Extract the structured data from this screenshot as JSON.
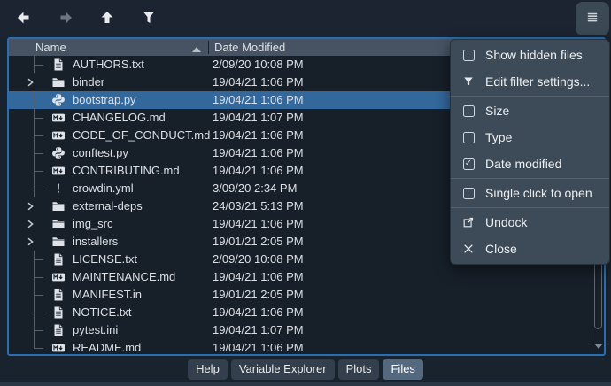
{
  "toolbar": {
    "back_label": "back",
    "forward_label": "forward",
    "up_label": "parent directory",
    "filter_label": "filter",
    "options_label": "options menu"
  },
  "file_browser": {
    "columns": {
      "name": "Name",
      "date": "Date Modified"
    },
    "sort": {
      "column": "Name",
      "direction": "ascending"
    },
    "rows": [
      {
        "name": "AUTHORS.txt",
        "date": "2/09/20 10:08 PM",
        "type": "text",
        "selected": false
      },
      {
        "name": "binder",
        "date": "19/04/21 1:06 PM",
        "type": "folder",
        "selected": false
      },
      {
        "name": "bootstrap.py",
        "date": "19/04/21 1:06 PM",
        "type": "python",
        "selected": true
      },
      {
        "name": "CHANGELOG.md",
        "date": "19/04/21 1:07 PM",
        "type": "markdown",
        "selected": false
      },
      {
        "name": "CODE_OF_CONDUCT.md",
        "date": "19/04/21 1:06 PM",
        "type": "markdown",
        "selected": false
      },
      {
        "name": "conftest.py",
        "date": "19/04/21 1:06 PM",
        "type": "python",
        "selected": false
      },
      {
        "name": "CONTRIBUTING.md",
        "date": "19/04/21 1:06 PM",
        "type": "markdown",
        "selected": false
      },
      {
        "name": "crowdin.yml",
        "date": "3/09/20 2:34 PM",
        "type": "yaml",
        "selected": false
      },
      {
        "name": "external-deps",
        "date": "24/03/21 5:13 PM",
        "type": "folder",
        "selected": false
      },
      {
        "name": "img_src",
        "date": "19/04/21 1:06 PM",
        "type": "folder",
        "selected": false
      },
      {
        "name": "installers",
        "date": "19/01/21 2:05 PM",
        "type": "folder",
        "selected": false
      },
      {
        "name": "LICENSE.txt",
        "date": "2/09/20 10:08 PM",
        "type": "text",
        "selected": false
      },
      {
        "name": "MAINTENANCE.md",
        "date": "19/04/21 1:06 PM",
        "type": "markdown",
        "selected": false
      },
      {
        "name": "MANIFEST.in",
        "date": "19/01/21 2:05 PM",
        "type": "text",
        "selected": false
      },
      {
        "name": "NOTICE.txt",
        "date": "19/04/21 1:06 PM",
        "type": "text",
        "selected": false
      },
      {
        "name": "pytest.ini",
        "date": "19/04/21 1:07 PM",
        "type": "text",
        "selected": false
      },
      {
        "name": "README.md",
        "date": "19/04/21 1:06 PM",
        "type": "markdown",
        "selected": false
      }
    ]
  },
  "context_menu": {
    "items": [
      {
        "label": "Show hidden files",
        "control": "checkbox",
        "checked": false
      },
      {
        "label": "Edit filter settings...",
        "control": "icon",
        "icon": "filter-icon"
      },
      {
        "separator": true
      },
      {
        "label": "Size",
        "control": "checkbox",
        "checked": false
      },
      {
        "label": "Type",
        "control": "checkbox",
        "checked": false
      },
      {
        "label": "Date modified",
        "control": "checkbox",
        "checked": true
      },
      {
        "separator": true
      },
      {
        "label": "Single click to open",
        "control": "checkbox",
        "checked": false
      },
      {
        "separator": true
      },
      {
        "label": "Undock",
        "control": "icon",
        "icon": "undock-icon"
      },
      {
        "label": "Close",
        "control": "icon",
        "icon": "close-icon"
      }
    ]
  },
  "tabs": [
    {
      "label": "Help",
      "active": false
    },
    {
      "label": "Variable Explorer",
      "active": false
    },
    {
      "label": "Plots",
      "active": false
    },
    {
      "label": "Files",
      "active": true
    }
  ],
  "colors": {
    "background": "#19232d",
    "header": "#475363",
    "selection": "#33689c",
    "focus_border": "#2a6db1",
    "menu_background": "#3d4a57",
    "active_tab": "#54697e",
    "text": "#dce0e4"
  }
}
